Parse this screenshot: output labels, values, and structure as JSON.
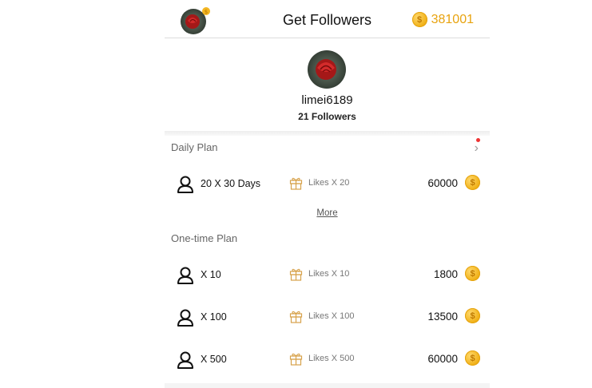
{
  "header": {
    "title": "Get Followers",
    "balance": "381001"
  },
  "profile": {
    "username": "limei6189",
    "followers": "21 Followers"
  },
  "daily_plan": {
    "title": "Daily Plan",
    "items": [
      {
        "qty": "20 X 30 Days",
        "likes": "Likes X 20",
        "price": "60000"
      }
    ],
    "more_label": "More"
  },
  "onetime_plan": {
    "title": "One-time Plan",
    "items": [
      {
        "qty": "X 10",
        "likes": "Likes X 10",
        "price": "1800"
      },
      {
        "qty": "X 100",
        "likes": "Likes X 100",
        "price": "13500"
      },
      {
        "qty": "X 500",
        "likes": "Likes X 500",
        "price": "60000"
      }
    ]
  },
  "icons": {
    "coin": "coin-icon",
    "person": "person-icon",
    "gift": "gift-icon",
    "chevron": "chevron-right-icon"
  },
  "colors": {
    "accent": "#e8a30f",
    "notification_dot": "#e33333"
  }
}
